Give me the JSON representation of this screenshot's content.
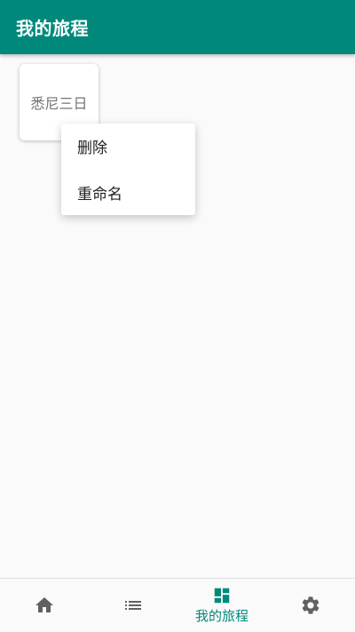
{
  "appbar": {
    "title": "我的旅程"
  },
  "trips": [
    {
      "name": "悉尼三日"
    }
  ],
  "context_menu": {
    "items": [
      {
        "label": "删除"
      },
      {
        "label": "重命名"
      }
    ]
  },
  "bottom_nav": {
    "items": [
      {
        "icon": "home-icon",
        "label": ""
      },
      {
        "icon": "list-icon",
        "label": ""
      },
      {
        "icon": "dashboard-icon",
        "label": "我的旅程",
        "active": true
      },
      {
        "icon": "gear-icon",
        "label": ""
      }
    ]
  },
  "colors": {
    "primary": "#00897b",
    "icon_inactive": "#616161",
    "background": "#fafafa"
  }
}
